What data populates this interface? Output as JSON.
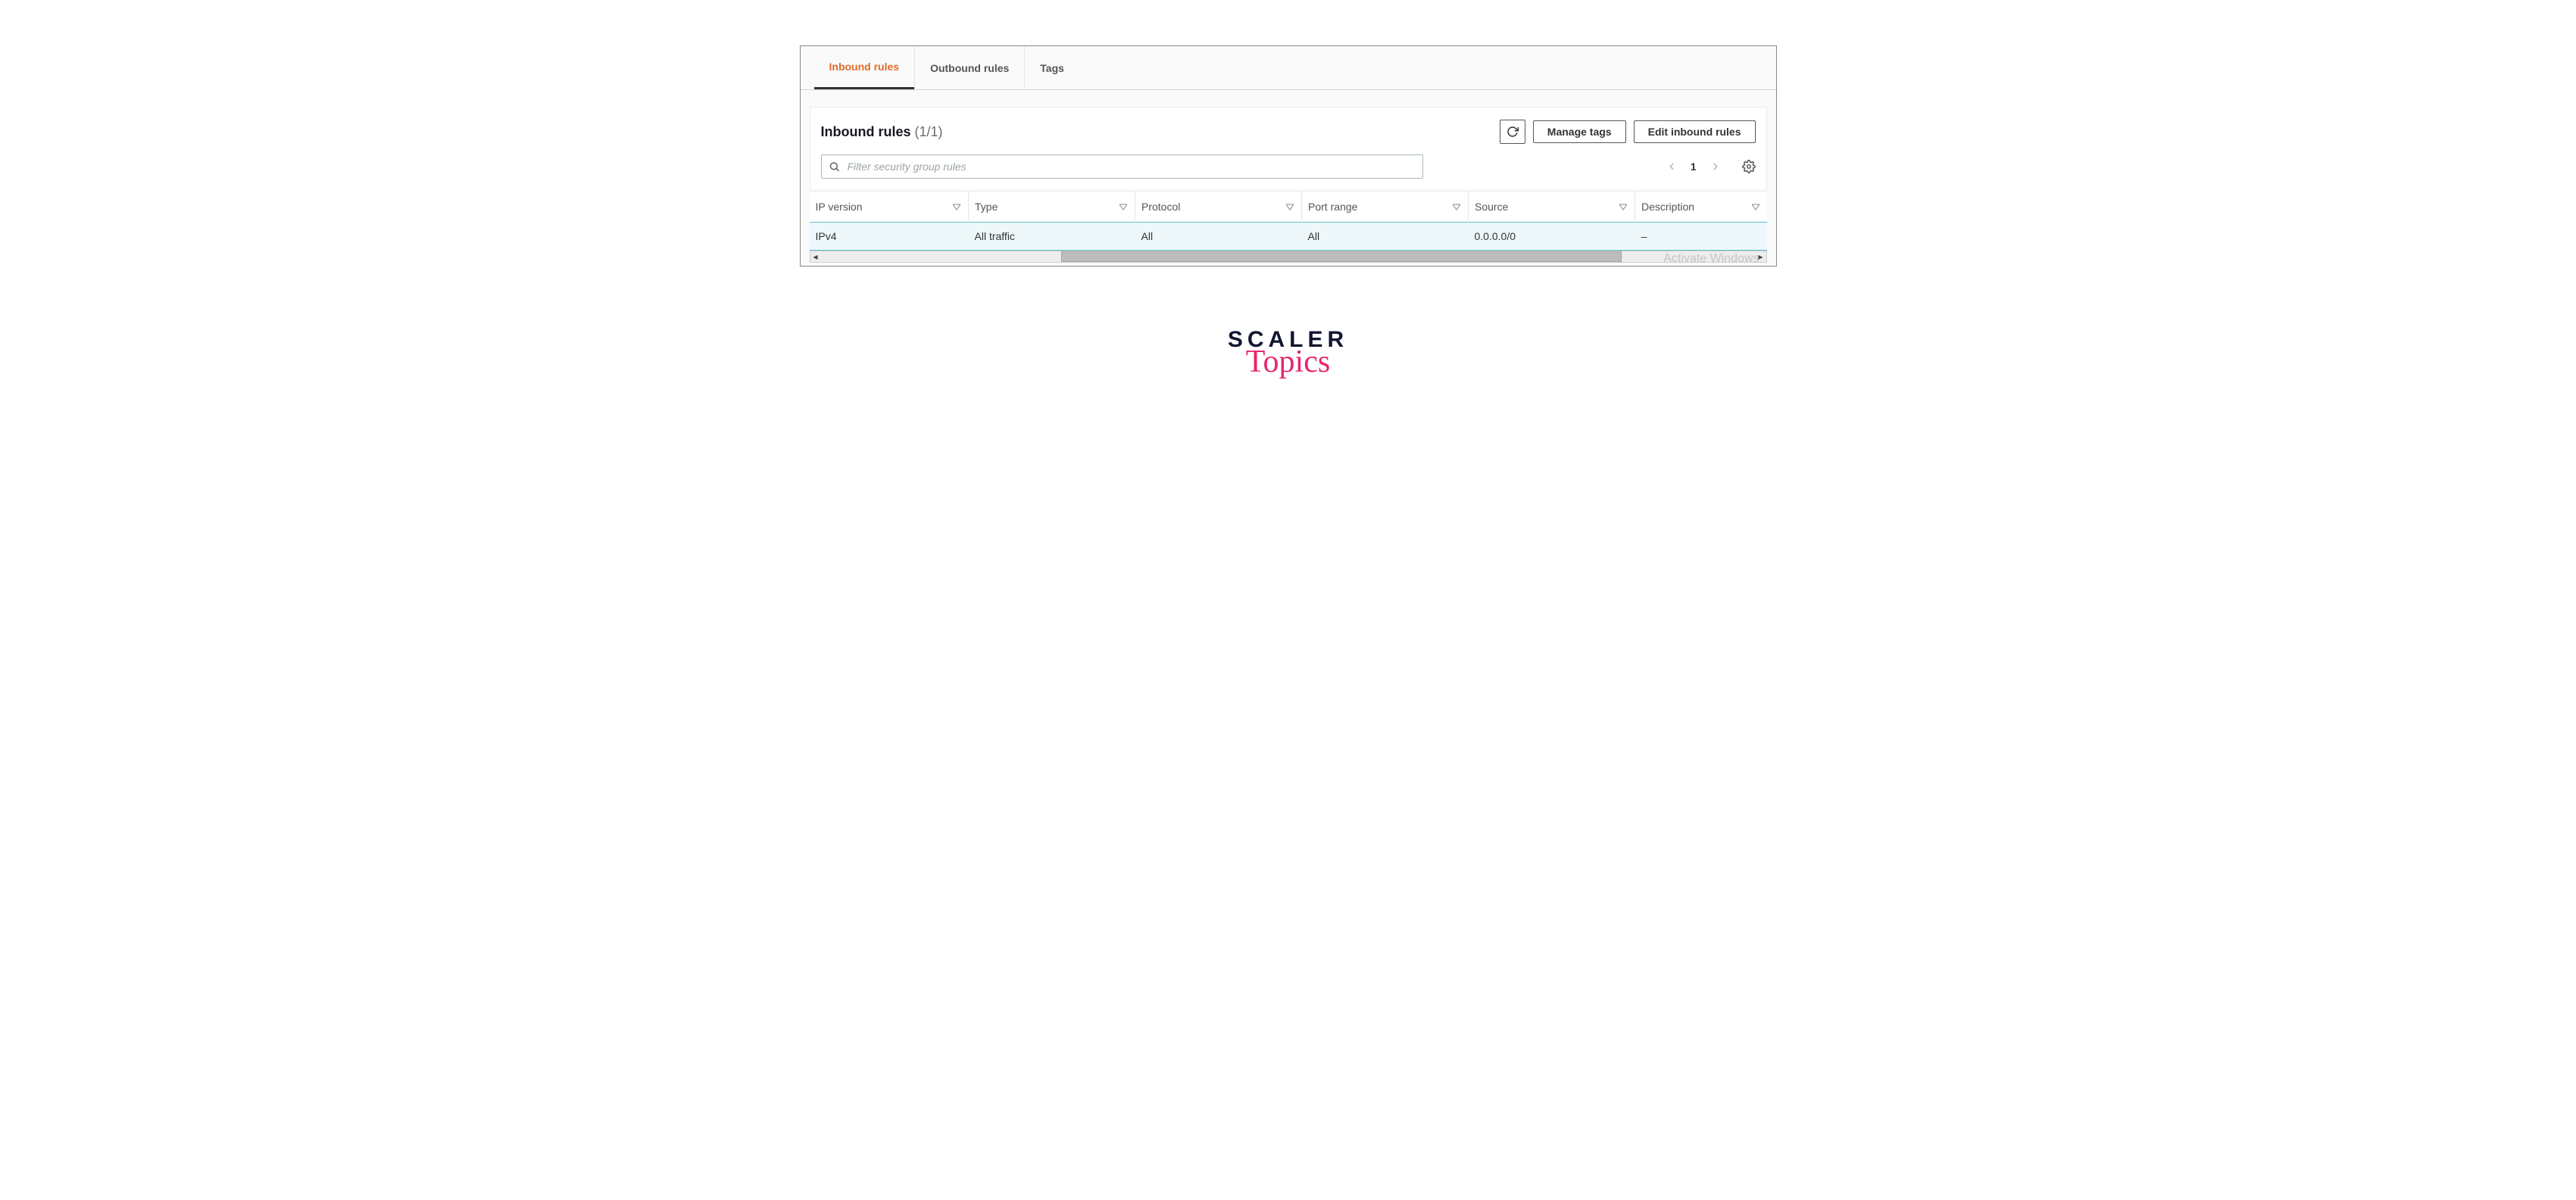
{
  "tabs": {
    "inbound": "Inbound rules",
    "outbound": "Outbound rules",
    "tags": "Tags"
  },
  "section": {
    "title": "Inbound rules",
    "count": "(1/1)"
  },
  "actions": {
    "refresh": "Refresh",
    "manage_tags": "Manage tags",
    "edit_rules": "Edit inbound rules"
  },
  "search": {
    "placeholder": "Filter security group rules"
  },
  "pager": {
    "page": "1"
  },
  "columns": {
    "ip_version": "IP version",
    "type": "Type",
    "protocol": "Protocol",
    "port_range": "Port range",
    "source": "Source",
    "description": "Description"
  },
  "rows": [
    {
      "ip_version": "IPv4",
      "type": "All traffic",
      "protocol": "All",
      "port_range": "All",
      "source": "0.0.0.0/0",
      "description": "–"
    }
  ],
  "watermark": "Activate Windows",
  "logo": {
    "line1": "SCALER",
    "line2": "Topics"
  }
}
